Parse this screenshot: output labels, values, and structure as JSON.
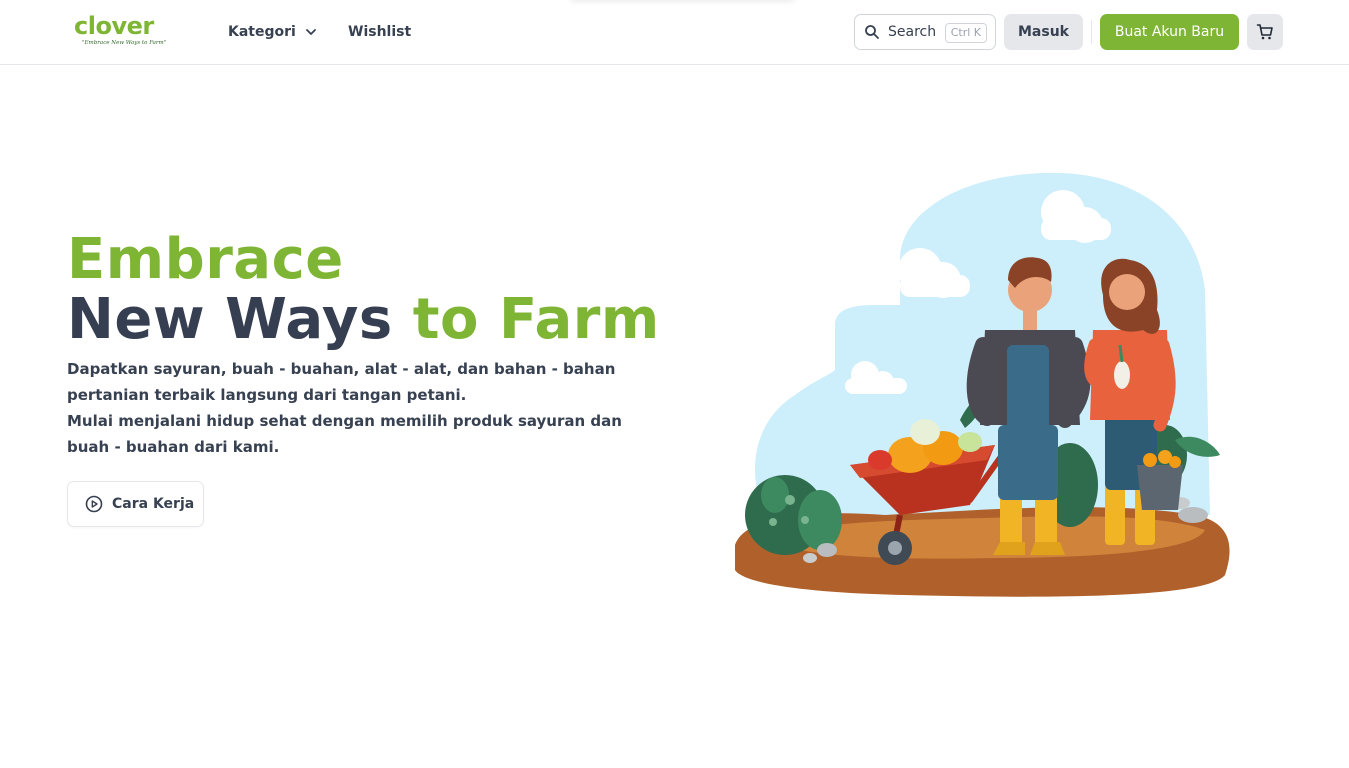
{
  "brand": {
    "name": "clover",
    "tagline": "\"Embrace New Ways to Farm\""
  },
  "nav": {
    "kategori_label": "Kategori",
    "wishlist_label": "Wishlist",
    "search_label": "Search",
    "search_shortcut": "Ctrl K",
    "login_label": "Masuk",
    "register_label": "Buat Akun Baru"
  },
  "hero": {
    "title_line1": "Embrace",
    "title_line2_dark": "New Ways",
    "title_line2_green": "to Farm",
    "desc_line1": "Dapatkan sayuran, buah - buahan, alat - alat, dan bahan - bahan",
    "desc_line2": "pertanian terbaik langsung dari tangan petani.",
    "desc_line3": "Mulai menjalani hidup sehat dengan memilih produk sayuran dan",
    "desc_line4": "buah - buahan dari kami.",
    "cta_label": "Cara Kerja"
  },
  "colors": {
    "accent": "#7fb534",
    "heading_dark": "#363f52",
    "text": "#374151",
    "button_gray": "#e5e7eb"
  },
  "icons": {
    "search": "search-icon",
    "chevron": "chevron-down-icon",
    "cart": "cart-icon",
    "play": "play-circle-icon"
  }
}
